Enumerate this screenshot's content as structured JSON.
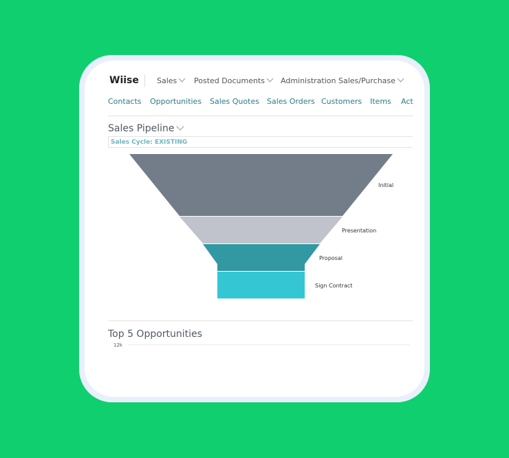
{
  "header": {
    "brand": "Wiise",
    "menus": [
      "Sales",
      "Posted Documents",
      "Administration Sales/Purchase"
    ]
  },
  "nav": [
    "Contacts",
    "Opportunities",
    "Sales Quotes",
    "Sales Orders",
    "Customers",
    "Items",
    "Act"
  ],
  "pipeline": {
    "title": "Sales Pipeline",
    "filter": "Sales Cycle: EXISTING",
    "stages": [
      {
        "label": "Initial",
        "color": "#737d8a"
      },
      {
        "label": "Presentation",
        "color": "#c0c3cc"
      },
      {
        "label": "Proposal",
        "color": "#3298a2"
      },
      {
        "label": "Sign Contract",
        "color": "#35c6d4"
      }
    ]
  },
  "top5": {
    "title": "Top 5 Opportunities",
    "y_tick": "12k"
  },
  "colors": {
    "background": "#10cf6e",
    "link": "#2a7d87"
  }
}
